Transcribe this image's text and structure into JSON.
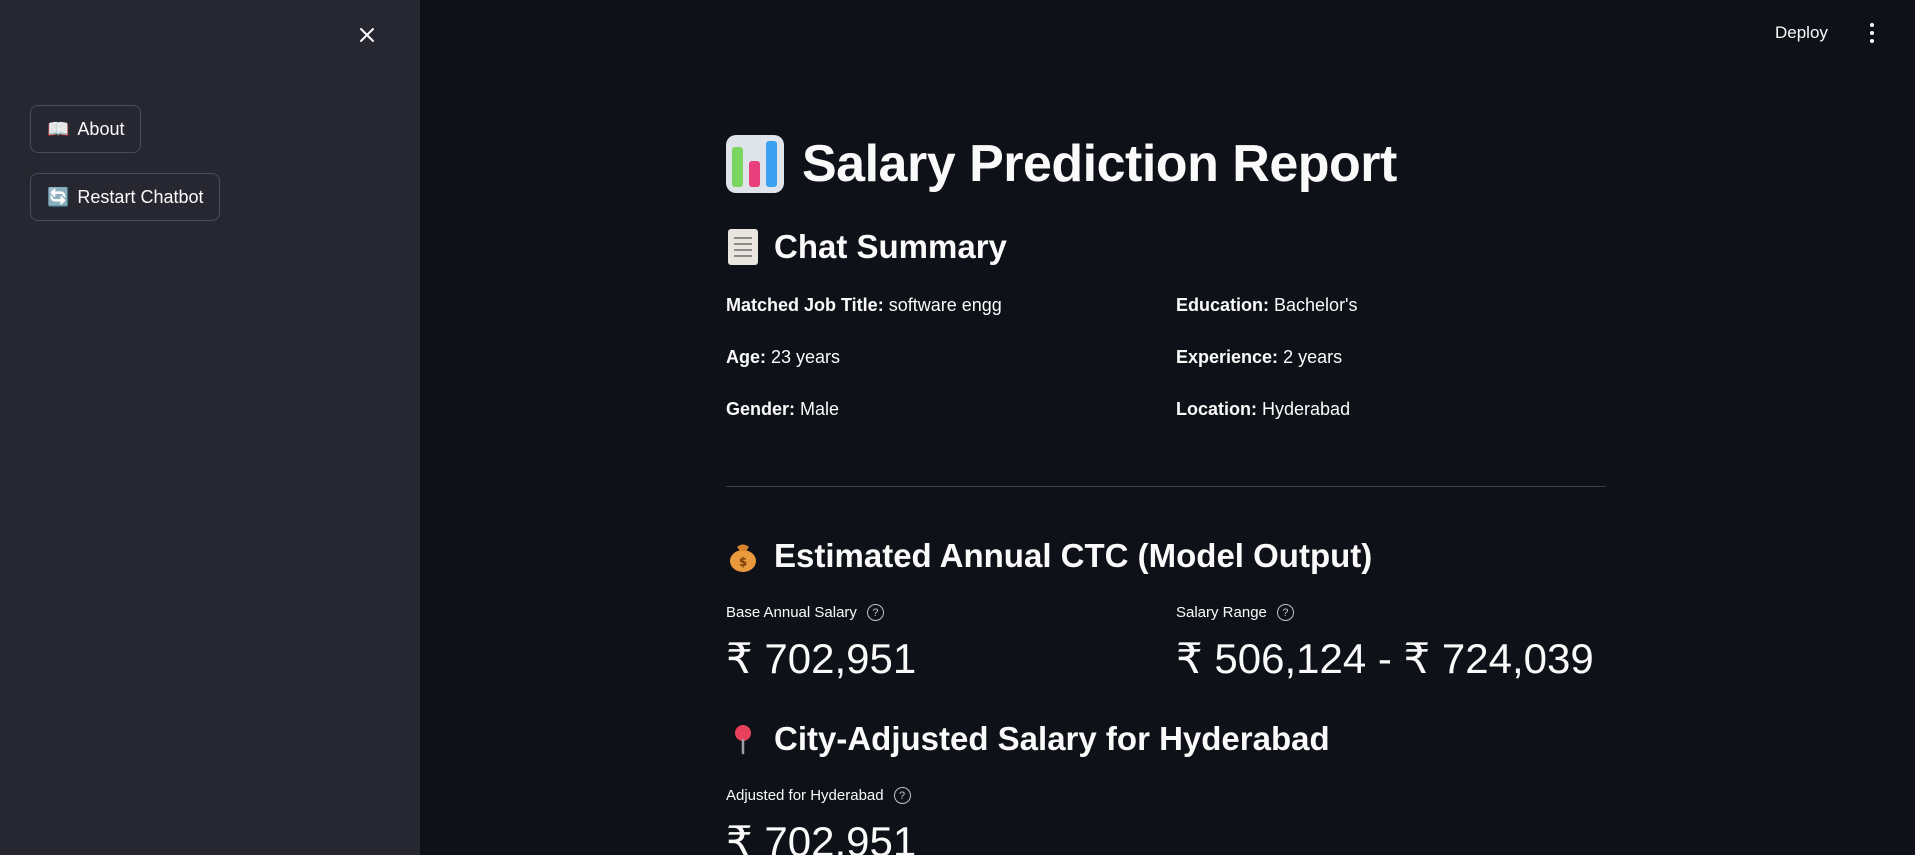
{
  "sidebar": {
    "about_label": "About",
    "about_emoji": "📖",
    "restart_label": "Restart Chatbot",
    "restart_emoji": "🔄"
  },
  "topbar": {
    "deploy_label": "Deploy"
  },
  "main": {
    "title": "Salary Prediction Report",
    "chat_summary": {
      "heading": "Chat Summary",
      "items": [
        {
          "label": "Matched Job Title:",
          "value": "software engg"
        },
        {
          "label": "Education:",
          "value": "Bachelor's"
        },
        {
          "label": "Age:",
          "value": "23 years"
        },
        {
          "label": "Experience:",
          "value": "2 years"
        },
        {
          "label": "Gender:",
          "value": "Male"
        },
        {
          "label": "Location:",
          "value": "Hyderabad"
        }
      ]
    },
    "ctc": {
      "heading": "Estimated Annual CTC (Model Output)",
      "base_label": "Base Annual Salary",
      "base_value": "₹ 702,951",
      "range_label": "Salary Range",
      "range_value": "₹ 506,124 - ₹ 724,039"
    },
    "city": {
      "heading": "City-Adjusted Salary for Hyderabad",
      "adjusted_label": "Adjusted for Hyderabad",
      "adjusted_value": "₹ 702,951"
    }
  },
  "colors": {
    "main_bg": "#0e1117",
    "sidebar_bg": "#262730",
    "text": "#fafafa"
  }
}
